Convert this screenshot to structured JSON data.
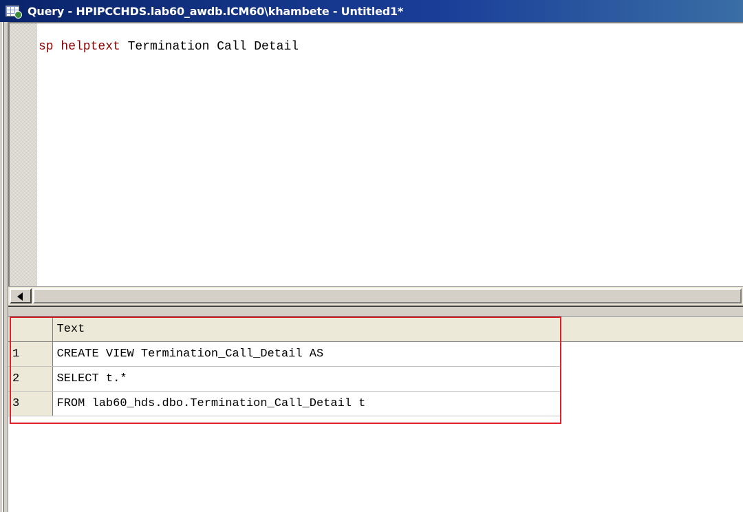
{
  "window": {
    "title": "Query - HPIPCCHDS.lab60_awdb.ICM60\\khambete - Untitled1*",
    "icon": "query-window-icon"
  },
  "editor": {
    "keyword": "sp helptext",
    "argument": " Termination Call Detail"
  },
  "results": {
    "column_header": "Text",
    "rows": [
      {
        "num": "1",
        "text": "CREATE VIEW Termination_Call_Detail AS"
      },
      {
        "num": "2",
        "text": "SELECT t.*"
      },
      {
        "num": "3",
        "text": "FROM lab60_hds.dbo.Termination_Call_Detail t"
      }
    ]
  },
  "colors": {
    "titlebar": "#0a246a",
    "keyword": "#8b0000",
    "highlight": "#e0202a"
  }
}
